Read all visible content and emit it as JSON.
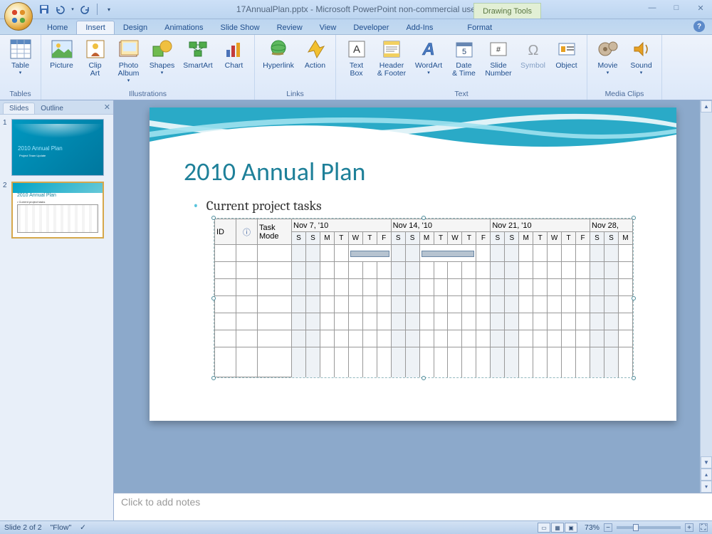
{
  "app": {
    "title": "17AnnualPlan.pptx - Microsoft PowerPoint non-commercial use",
    "context_tab_header": "Drawing Tools"
  },
  "qat": {
    "save": "save-icon",
    "undo": "undo-icon",
    "redo": "redo-icon"
  },
  "tabs": {
    "home": "Home",
    "insert": "Insert",
    "design": "Design",
    "animations": "Animations",
    "slideshow": "Slide Show",
    "review": "Review",
    "view": "View",
    "developer": "Developer",
    "addins": "Add-Ins",
    "format": "Format"
  },
  "ribbon": {
    "groups": {
      "tables": "Tables",
      "illustrations": "Illustrations",
      "links": "Links",
      "text": "Text",
      "mediaclips": "Media Clips"
    },
    "buttons": {
      "table": "Table",
      "picture": "Picture",
      "clipart": "Clip\nArt",
      "photoalbum": "Photo\nAlbum",
      "shapes": "Shapes",
      "smartart": "SmartArt",
      "chart": "Chart",
      "hyperlink": "Hyperlink",
      "action": "Action",
      "textbox": "Text\nBox",
      "headerfooter": "Header\n& Footer",
      "wordart": "WordArt",
      "datetime": "Date\n& Time",
      "slidenumber": "Slide\nNumber",
      "symbol": "Symbol",
      "object": "Object",
      "movie": "Movie",
      "sound": "Sound"
    }
  },
  "slides_pane": {
    "tab_slides": "Slides",
    "tab_outline": "Outline",
    "thumb1_title": "2010 Annual Plan",
    "thumb1_sub": "Project Team Update",
    "thumb2_title": "2010 Annual Plan",
    "thumb2_bullet": "Current project tasks"
  },
  "slide": {
    "title": "2010 Annual Plan",
    "bullet": "Current project tasks",
    "gantt": {
      "col_id": "ID",
      "col_info": "ⓘ",
      "col_mode": "Task\nMode",
      "weeks": [
        "Nov 7, '10",
        "Nov 14, '10",
        "Nov 21, '10",
        "Nov 28,"
      ],
      "days": [
        "S",
        "S",
        "M",
        "T",
        "W",
        "T",
        "F",
        "S",
        "S",
        "M",
        "T",
        "W",
        "T",
        "F",
        "S",
        "S",
        "M",
        "T",
        "W",
        "T",
        "F",
        "S",
        "S",
        "M"
      ]
    }
  },
  "notes": {
    "placeholder": "Click to add notes"
  },
  "status": {
    "slide_info": "Slide 2 of 2",
    "theme": "\"Flow\"",
    "zoom": "73%"
  }
}
